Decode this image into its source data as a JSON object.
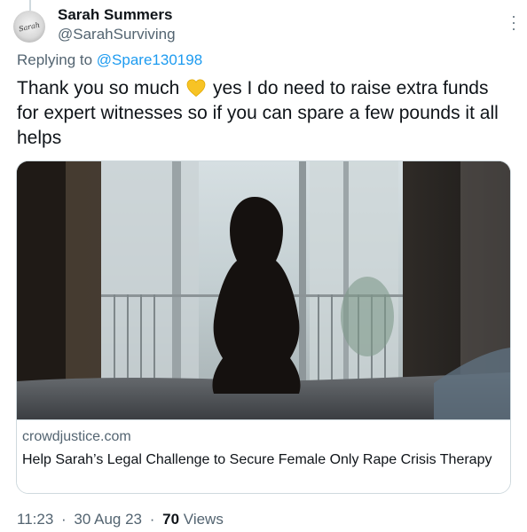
{
  "author": {
    "display_name": "Sarah Summers",
    "handle": "@SarahSurviving",
    "avatar_icon": "handwritten-signature-avatar"
  },
  "reply": {
    "prefix": "Replying to",
    "mention": "@Spare130198"
  },
  "tweet": {
    "text_before_emoji": "Thank you so much",
    "emoji": "yellow-heart-icon",
    "text_after_emoji": "yes I do need to raise extra funds for expert witnesses so if you can spare a few pounds it all helps"
  },
  "card": {
    "domain": "crowdjustice.com",
    "title": "Help Sarah’s Legal Challenge to Secure Female Only Rape Crisis Therapy",
    "image": "woman-silhouette-at-window-photo"
  },
  "meta": {
    "time": "11:23",
    "separator": "·",
    "date": "30 Aug 23",
    "views_count": "70",
    "views_label": "Views"
  },
  "colors": {
    "text": "#0f1419",
    "secondary": "#536471",
    "link": "#1d9bf0",
    "border": "#cfd9de",
    "heart": "#f7c325"
  }
}
